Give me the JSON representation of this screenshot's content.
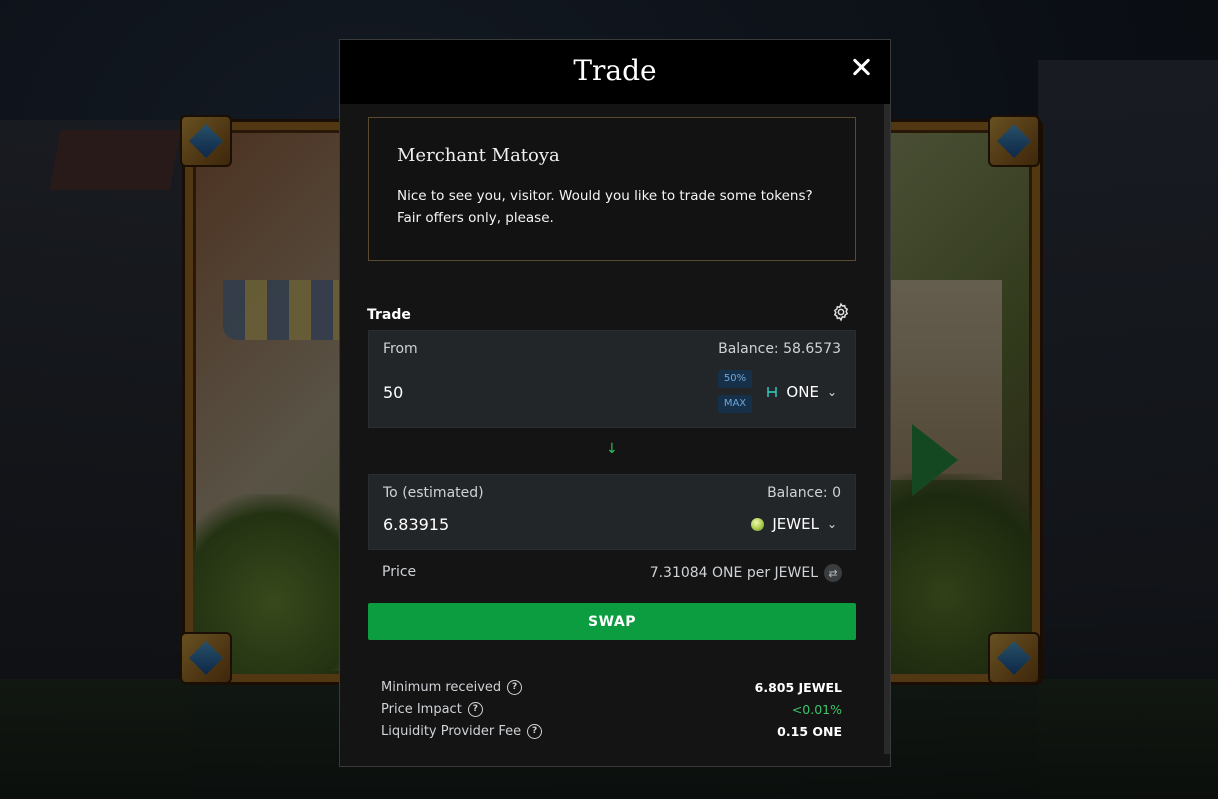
{
  "modal": {
    "title": "Trade"
  },
  "merchant": {
    "name": "Merchant Matoya",
    "message": "Nice to see you, visitor. Would you like to trade some tokens? Fair offers only, please."
  },
  "trade": {
    "section_label": "Trade",
    "from": {
      "label": "From",
      "balance": "Balance: 58.6573",
      "amount": "50",
      "pct_50": "50%",
      "pct_max": "MAX",
      "token": "ONE",
      "token_icon": "harmony-one-icon"
    },
    "to": {
      "label": "To (estimated)",
      "balance": "Balance: 0",
      "amount": "6.83915",
      "token": "JEWEL",
      "token_icon": "jewel-icon"
    },
    "price": {
      "label": "Price",
      "value": "7.31084 ONE per JEWEL"
    },
    "swap_label": "SWAP",
    "stats": [
      {
        "label": "Minimum received",
        "value": "6.805 JEWEL"
      },
      {
        "label": "Price Impact",
        "value": "<0.01%"
      },
      {
        "label": "Liquidity Provider Fee",
        "value": "0.15 ONE"
      }
    ]
  },
  "colors": {
    "accent_green": "#0b9d40",
    "impact_green": "#3ec46a",
    "panel_bg": "#232629",
    "modal_bg": "#141414"
  }
}
